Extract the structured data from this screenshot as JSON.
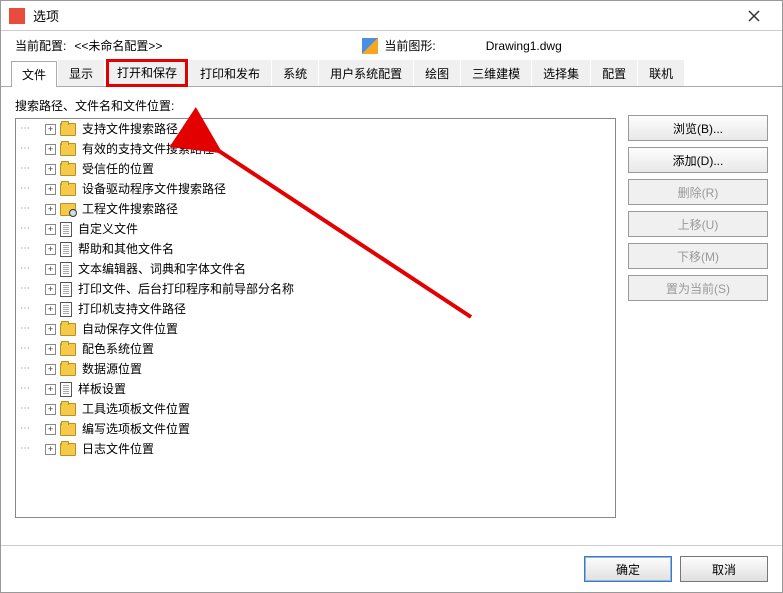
{
  "window": {
    "title": "选项"
  },
  "info": {
    "current_config_label": "当前配置:",
    "current_config_value": "<<未命名配置>>",
    "current_drawing_label": "当前图形:",
    "current_drawing_value": "Drawing1.dwg"
  },
  "tabs": [
    {
      "label": "文件",
      "active": true
    },
    {
      "label": "显示"
    },
    {
      "label": "打开和保存",
      "highlighted": true
    },
    {
      "label": "打印和发布"
    },
    {
      "label": "系统"
    },
    {
      "label": "用户系统配置"
    },
    {
      "label": "绘图"
    },
    {
      "label": "三维建模"
    },
    {
      "label": "选择集"
    },
    {
      "label": "配置"
    },
    {
      "label": "联机"
    }
  ],
  "section_label": "搜索路径、文件名和文件位置:",
  "tree": [
    {
      "icon": "folder",
      "label": "支持文件搜索路径"
    },
    {
      "icon": "folder",
      "label": "有效的支持文件搜索路径"
    },
    {
      "icon": "folder",
      "label": "受信任的位置"
    },
    {
      "icon": "folder",
      "label": "设备驱动程序文件搜索路径"
    },
    {
      "icon": "search",
      "label": "工程文件搜索路径"
    },
    {
      "icon": "doc",
      "label": "自定义文件"
    },
    {
      "icon": "doc",
      "label": "帮助和其他文件名"
    },
    {
      "icon": "doc",
      "label": "文本编辑器、词典和字体文件名"
    },
    {
      "icon": "doc",
      "label": "打印文件、后台打印程序和前导部分名称"
    },
    {
      "icon": "doc",
      "label": "打印机支持文件路径"
    },
    {
      "icon": "folder",
      "label": "自动保存文件位置"
    },
    {
      "icon": "folder",
      "label": "配色系统位置"
    },
    {
      "icon": "folder",
      "label": "数据源位置"
    },
    {
      "icon": "doc",
      "label": "样板设置"
    },
    {
      "icon": "folder",
      "label": "工具选项板文件位置"
    },
    {
      "icon": "folder",
      "label": "编写选项板文件位置"
    },
    {
      "icon": "folder",
      "label": "日志文件位置"
    }
  ],
  "side_buttons": {
    "browse": "浏览(B)...",
    "add": "添加(D)...",
    "delete": "删除(R)",
    "moveup": "上移(U)",
    "movedown": "下移(M)",
    "setcurrent": "置为当前(S)"
  },
  "bottom_buttons": {
    "ok": "确定",
    "cancel": "取消"
  }
}
